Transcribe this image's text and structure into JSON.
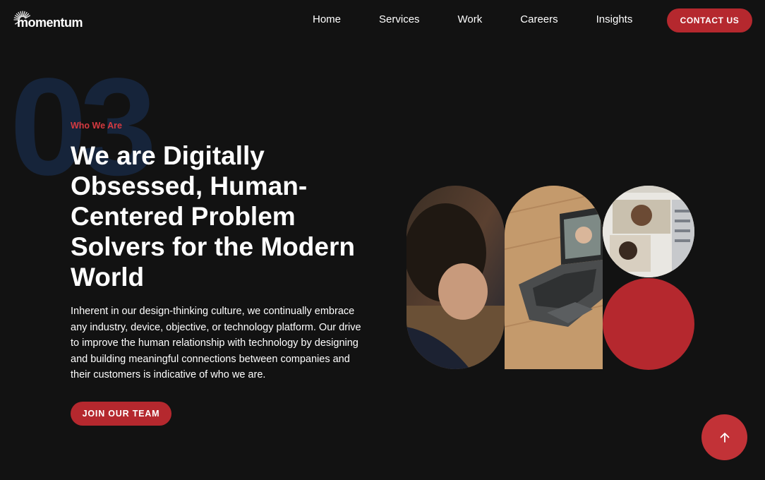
{
  "brand": {
    "logo_text": "momentum"
  },
  "nav": {
    "items": [
      {
        "label": "Home"
      },
      {
        "label": "Services"
      },
      {
        "label": "Work"
      },
      {
        "label": "Careers"
      },
      {
        "label": "Insights"
      }
    ],
    "cta_label": "CONTACT US"
  },
  "hero": {
    "section_number": "03",
    "eyebrow": "Who We Are",
    "headline": "We are Digitally Obsessed, Human-Centered Problem Solvers for the Modern World",
    "body": "Inherent in our design-thinking culture, we continually embrace any industry, device, objective, or technology platform. Our drive to improve the human relationship with technology by designing and building meaningful connections between companies and their customers is indicative of who we are.",
    "cta_label": "JOIN OUR TEAM"
  },
  "colors": {
    "background": "#121212",
    "accent": "#b5282e",
    "eyebrow": "#d63a40",
    "section_number": "#16243a"
  },
  "icons": {
    "logo": "sunburst-logo-icon",
    "scroll_top": "arrow-up-icon"
  }
}
